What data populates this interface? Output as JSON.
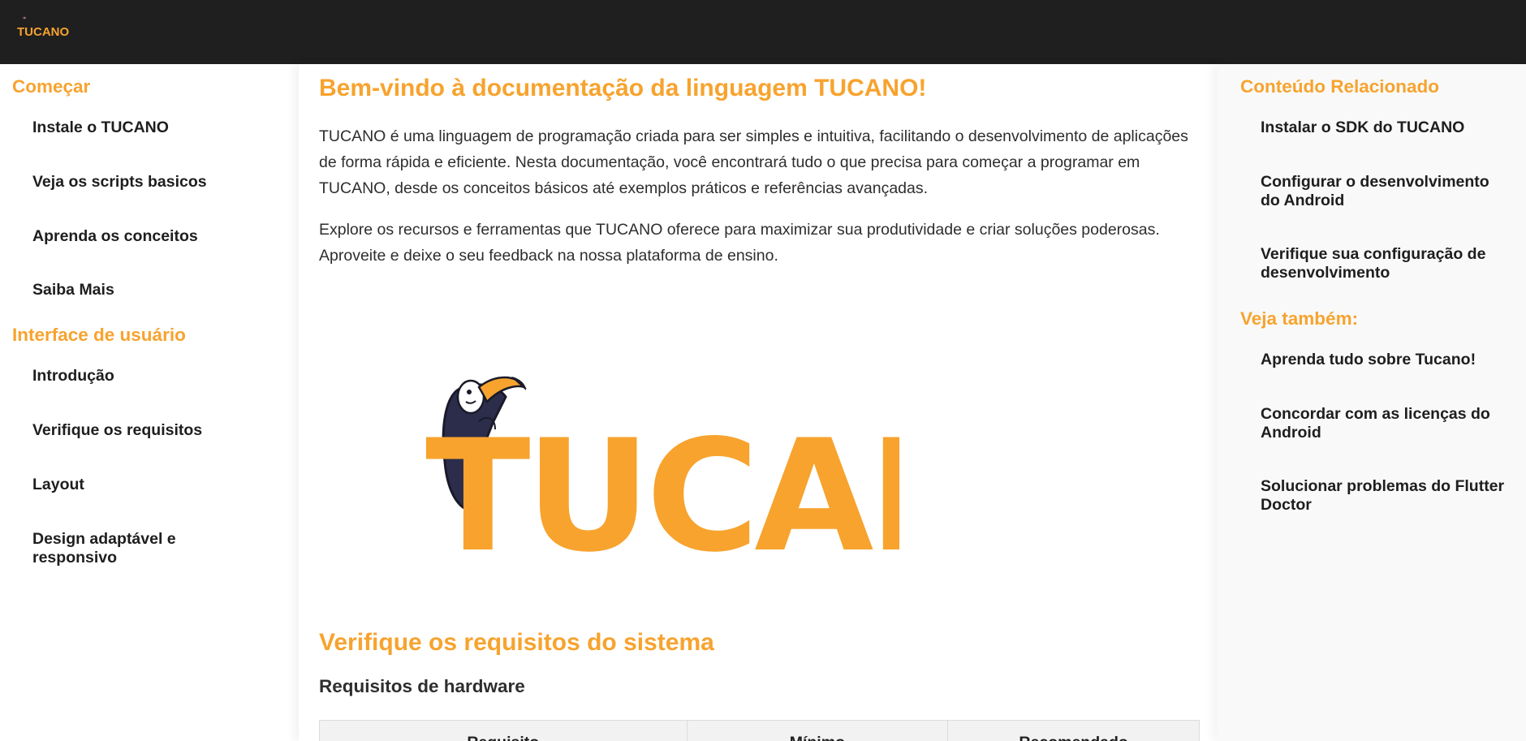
{
  "header": {
    "logo_text": "TUCANO"
  },
  "left_nav": {
    "sections": [
      {
        "title": "Começar",
        "items": [
          "Instale o TUCANO",
          "Veja os scripts basicos",
          "Aprenda os conceitos",
          "Saiba Mais"
        ]
      },
      {
        "title": "Interface de usuário",
        "items": [
          "Introdução",
          "Verifique os requisitos",
          "Layout",
          "Design adaptável e responsivo"
        ]
      }
    ]
  },
  "main": {
    "title": "Bem-vindo à documentação da linguagem TUCANO!",
    "paragraph1": "TUCANO é uma linguagem de programação criada para ser simples e intuitiva, facilitando o desenvolvimento de aplicações de forma rápida e eficiente. Nesta documentação, você encontrará tudo o que precisa para começar a programar em TUCANO, desde os conceitos básicos até exemplos práticos e referências avançadas.",
    "paragraph2": "Explore os recursos e ferramentas que TUCANO oferece para maximizar sua produtividade e criar soluções poderosas. Aproveite e deixe o seu feedback na nossa plataforma de ensino.",
    "hero_logo_text": "TUCANO",
    "requirements_title": "Verifique os requisitos do sistema",
    "hardware_title": "Requisitos de hardware",
    "table_headers": [
      "Requisito",
      "Mínimo",
      "Recomendado"
    ]
  },
  "right_nav": {
    "sections": [
      {
        "title": "Conteúdo Relacionado",
        "items": [
          "Instalar o SDK do TUCANO",
          "Configurar o desenvolvimento do Android",
          "Verifique sua configuração de desenvolvimento"
        ]
      },
      {
        "title": "Veja também:",
        "items": [
          "Aprenda tudo sobre Tucano!",
          "Concordar com as licenças do Android",
          "Solucionar problemas do Flutter Doctor"
        ]
      }
    ]
  },
  "colors": {
    "brand_orange": "#f7a32e",
    "topbar": "#1f1f1f",
    "toucan_body": "#2c2d4a"
  }
}
